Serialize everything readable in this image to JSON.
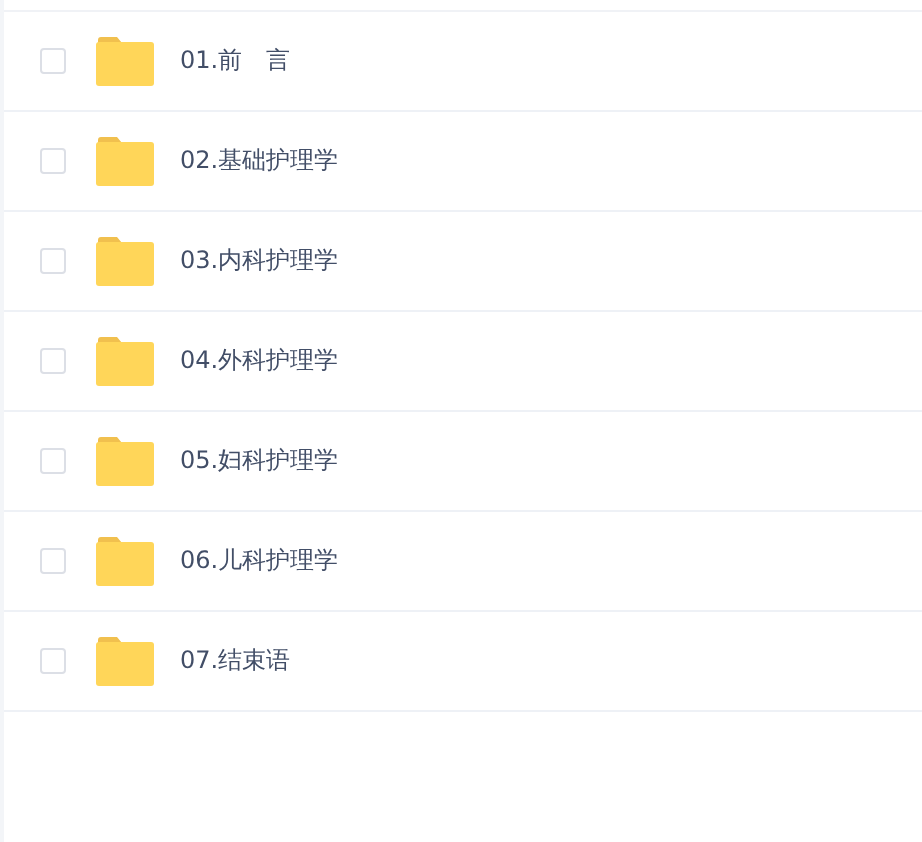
{
  "files": [
    {
      "name": "01.前　言",
      "checked": false
    },
    {
      "name": "02.基础护理学",
      "checked": false
    },
    {
      "name": "03.内科护理学",
      "checked": false
    },
    {
      "name": "04.外科护理学",
      "checked": false
    },
    {
      "name": "05.妇科护理学",
      "checked": false
    },
    {
      "name": "06.儿科护理学",
      "checked": false
    },
    {
      "name": "07.结束语",
      "checked": false
    }
  ]
}
